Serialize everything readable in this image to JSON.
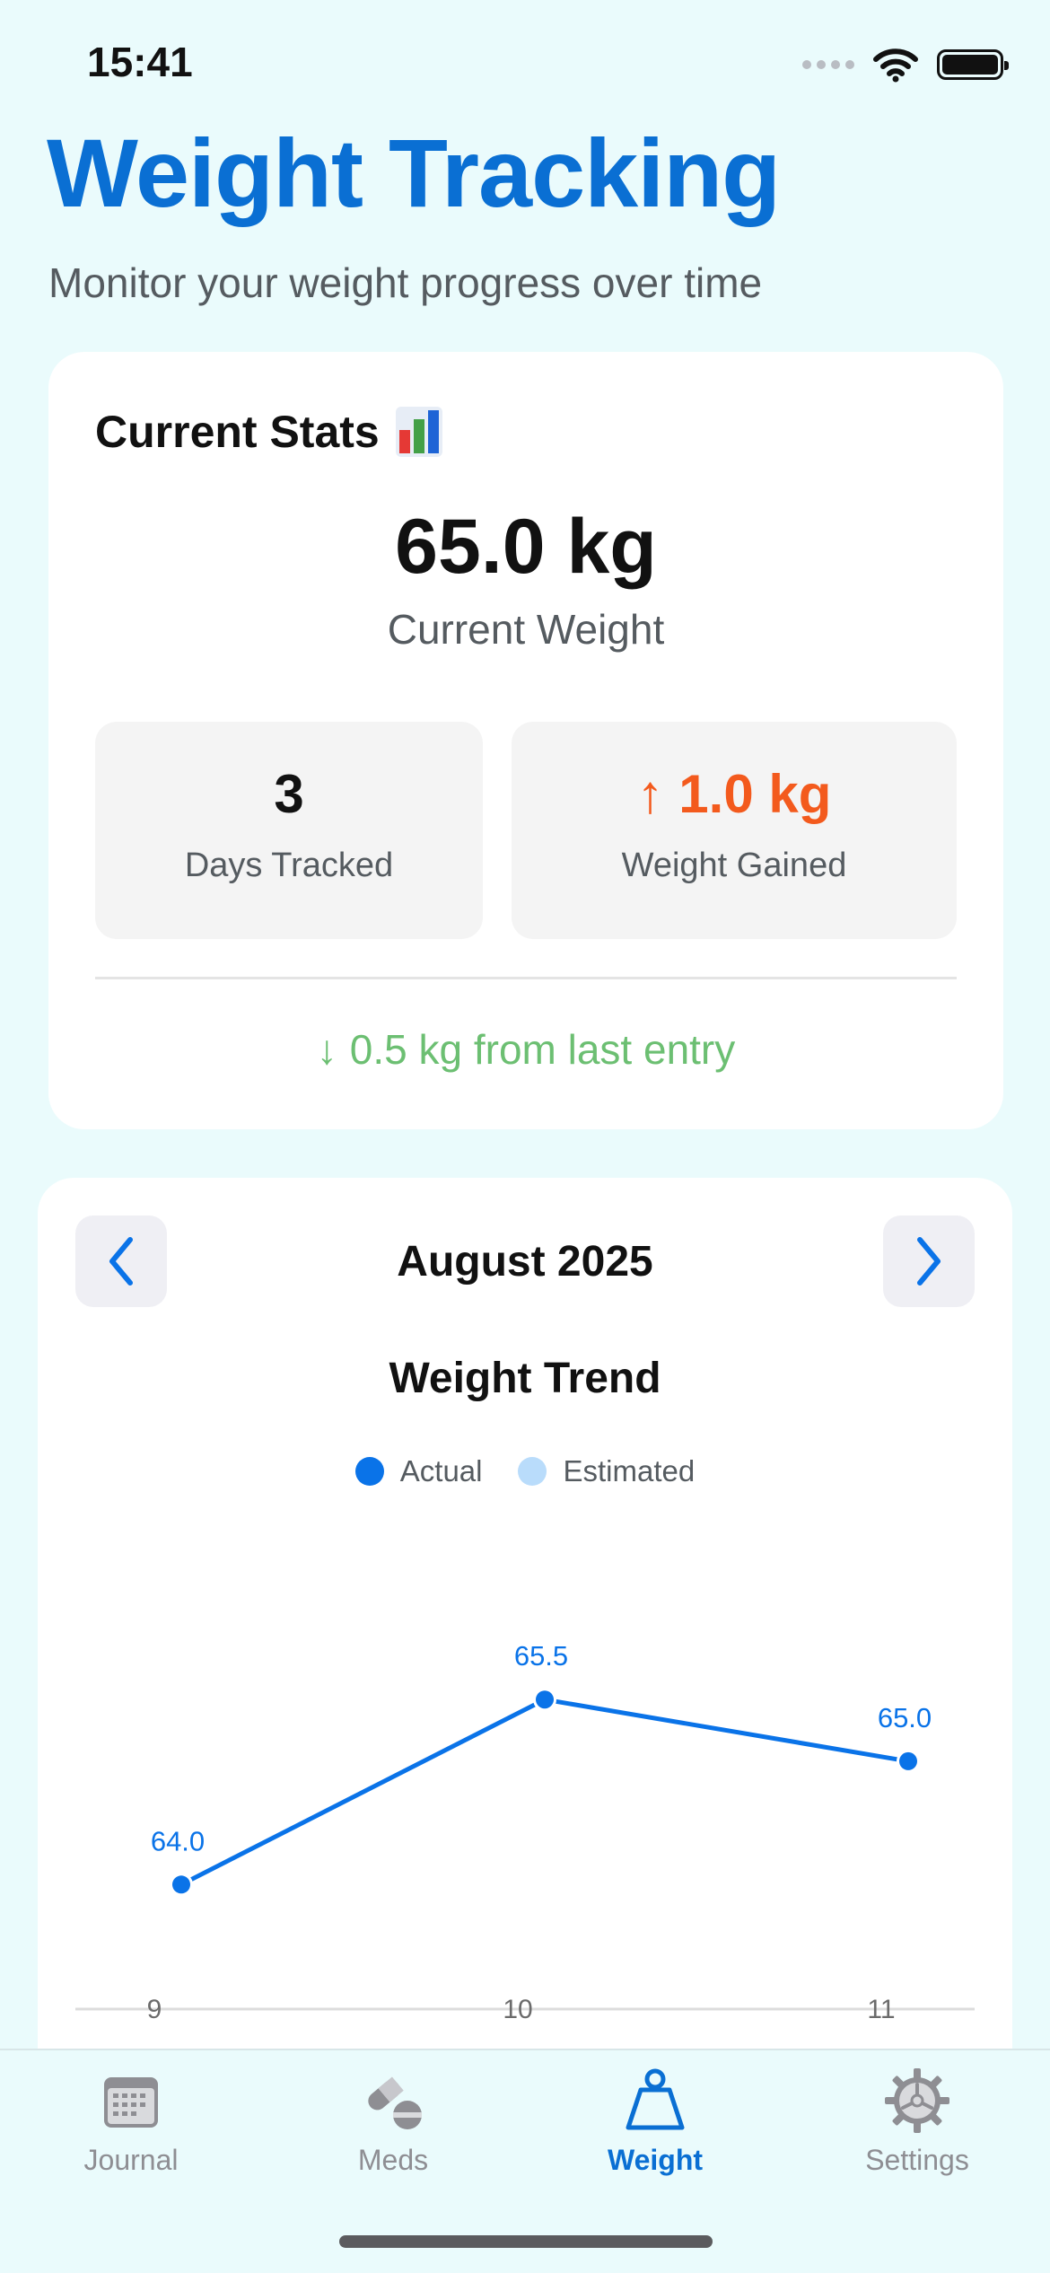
{
  "status_bar": {
    "time": "15:41"
  },
  "header": {
    "title": "Weight Tracking",
    "subtitle": "Monitor your weight progress over time"
  },
  "stats": {
    "heading": "Current Stats",
    "current_weight": "65.0 kg",
    "current_weight_label": "Current Weight",
    "days_tracked_value": "3",
    "days_tracked_label": "Days Tracked",
    "weight_gained_value": "1.0 kg",
    "weight_gained_arrow": "↑",
    "weight_gained_label": "Weight Gained",
    "last_entry_arrow": "↓",
    "last_entry_text": "0.5 kg from last entry",
    "colors": {
      "gain": "#f35a1d",
      "change": "#6cbf72"
    }
  },
  "chart_card": {
    "month": "August 2025"
  },
  "chart_data": {
    "type": "line",
    "title": "Weight Trend",
    "legend": [
      "Actual",
      "Estimated"
    ],
    "legend_colors": [
      "#0a73e8",
      "#b9dcfb"
    ],
    "x": [
      9,
      10,
      11
    ],
    "xtick_labels": [
      "9",
      "10",
      "11"
    ],
    "series": [
      {
        "name": "Actual",
        "values": [
          64.0,
          65.5,
          65.0
        ],
        "labels": [
          "64.0",
          "65.5",
          "65.0"
        ],
        "color": "#0a73e8"
      }
    ],
    "ylim": [
      63.5,
      65.8
    ],
    "grid": false
  },
  "tab_bar": {
    "tabs": [
      {
        "label": "Journal",
        "icon": "calendar-icon",
        "active": false
      },
      {
        "label": "Meds",
        "icon": "pills-icon",
        "active": false
      },
      {
        "label": "Weight",
        "icon": "scale-weight-icon",
        "active": true
      },
      {
        "label": "Settings",
        "icon": "gear-icon",
        "active": false
      }
    ],
    "colors": {
      "active": "#0a6fd3",
      "inactive": "#8e8e93"
    }
  }
}
